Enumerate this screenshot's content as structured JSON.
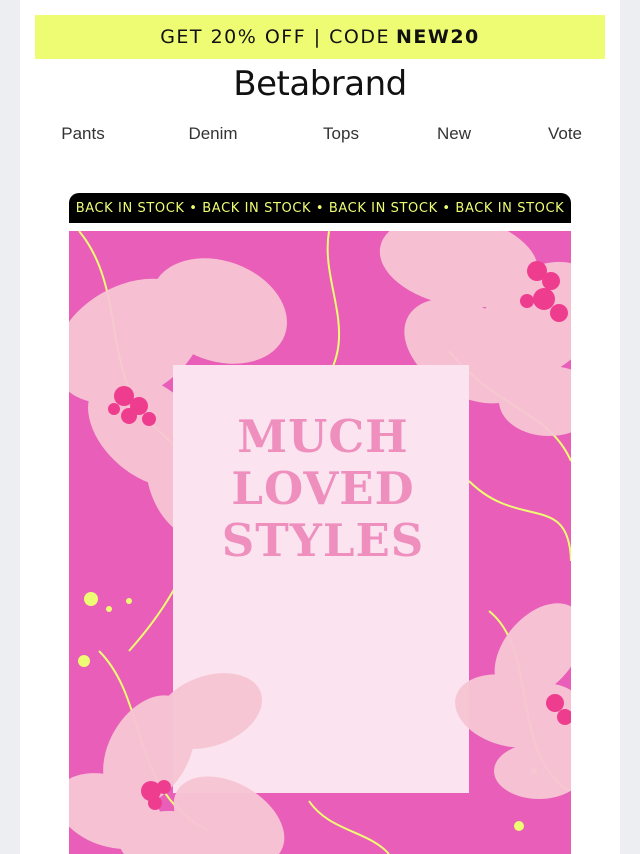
{
  "promo": {
    "text": "GET 20% OFF | CODE",
    "code": "NEW20"
  },
  "brand": {
    "logo": "Betabrand"
  },
  "nav": {
    "items": [
      "Pants",
      "Denim",
      "Tops",
      "New",
      "Vote"
    ]
  },
  "ticker": {
    "text": "BACK IN STOCK • BACK IN STOCK • BACK IN STOCK • BACK IN STOCK"
  },
  "hero": {
    "lines": [
      "MUCH",
      "LOVED",
      "STYLES"
    ]
  },
  "colors": {
    "promo_bg": "#eefc74",
    "hero_bg": "#e85eb8",
    "ticker_bg": "#000000",
    "ticker_text": "#eefc74",
    "hero_text": "#ee8fbe"
  }
}
